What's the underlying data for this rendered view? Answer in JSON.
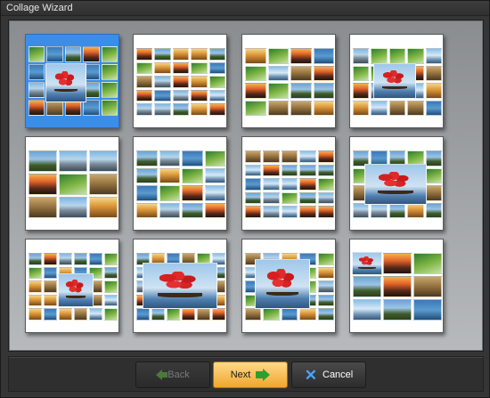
{
  "window": {
    "title": "Collage Wizard"
  },
  "gallery": {
    "selected_index": 0,
    "templates": [
      "template-1",
      "template-2",
      "template-3",
      "template-4",
      "template-5",
      "template-6",
      "template-7",
      "template-8",
      "template-9",
      "template-10",
      "template-11",
      "template-12"
    ]
  },
  "buttons": {
    "back": {
      "label": "Back",
      "icon": "arrow-left-icon",
      "enabled": false
    },
    "next": {
      "label": "Next",
      "icon": "arrow-right-icon",
      "enabled": true
    },
    "cancel": {
      "label": "Cancel",
      "icon": "close-icon",
      "enabled": true
    }
  },
  "colors": {
    "selection": "#3b8ee8",
    "next_button": "#f0a62c"
  }
}
